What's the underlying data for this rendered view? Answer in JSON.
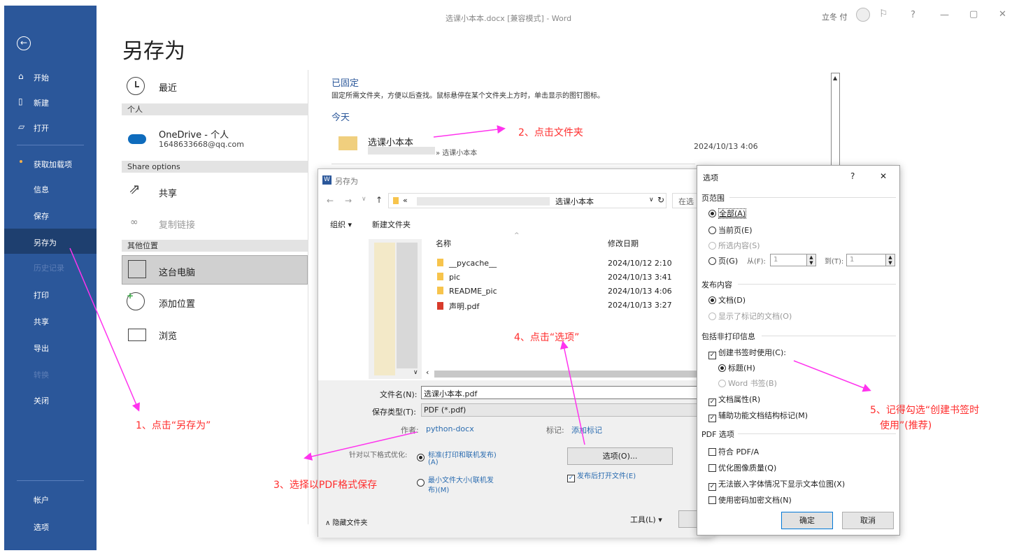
{
  "window": {
    "title": "选课小本本.docx [兼容模式] - Word",
    "user": "立冬 付",
    "controls": [
      "?",
      "—",
      "▢",
      "✕"
    ]
  },
  "rail": {
    "items": [
      {
        "label": "开始",
        "icon": "home-icon"
      },
      {
        "label": "新建",
        "icon": "new-doc-icon"
      },
      {
        "label": "打开",
        "icon": "open-folder-icon"
      },
      {
        "label": "获取加载项"
      },
      {
        "label": "信息"
      },
      {
        "label": "保存"
      },
      {
        "label": "另存为"
      },
      {
        "label": "历史记录"
      },
      {
        "label": "打印"
      },
      {
        "label": "共享"
      },
      {
        "label": "导出"
      },
      {
        "label": "转换"
      },
      {
        "label": "关闭"
      },
      {
        "label": "帐户"
      },
      {
        "label": "选项"
      }
    ]
  },
  "main": {
    "title": "另存为",
    "recent": "最近",
    "personal": "个人",
    "onedrive_name": "OneDrive - 个人",
    "onedrive_email": "1648633668@qq.com",
    "share_options": "Share options",
    "share": "共享",
    "copy_link": "复制链接",
    "other_locations": "其他位置",
    "this_pc": "这台电脑",
    "add_location": "添加位置",
    "browse": "浏览"
  },
  "pinned": {
    "title": "已固定",
    "desc": "固定所需文件夹，方便以后查找。鼠标悬停在某个文件夹上方时，单击显示的图钉图标。",
    "today": "今天",
    "folder_name": "选课小本本",
    "folder_path": "» 选课小本本",
    "folder_date": "2024/10/13 4:06"
  },
  "dialog": {
    "title": "另存为",
    "path_prefix": "«",
    "path_last": "选课小本本",
    "search": "在选",
    "organize": "组织 ▾",
    "new_folder": "新建文件夹",
    "col_name": "名称",
    "col_date": "修改日期",
    "files": [
      {
        "name": "__pycache__",
        "date": "2024/10/12 2:10",
        "type": "folder"
      },
      {
        "name": "pic",
        "date": "2024/10/13 3:41",
        "type": "folder"
      },
      {
        "name": "README_pic",
        "date": "2024/10/13 4:06",
        "type": "folder"
      },
      {
        "name": "声明.pdf",
        "date": "2024/10/13 3:27",
        "type": "pdf"
      }
    ],
    "filename_label": "文件名(N):",
    "filename_value": "选课小本本.pdf",
    "filetype_label": "保存类型(T):",
    "filetype_value": "PDF (*.pdf)",
    "author_label": "作者:",
    "author_value": "python-docx",
    "tags_label": "标记:",
    "tags_value": "添加标记",
    "optimize_label": "针对以下格式优化:",
    "opt_standard_line1": "标准(打印和联机发布)",
    "opt_standard_line2": "(A)",
    "opt_min_line1": "最小文件大小(联机发",
    "opt_min_line2": "布)(M)",
    "options_button": "选项(O)...",
    "open_after": "发布后打开文件(E)",
    "hide_folders": "∧ 隐藏文件夹",
    "tools": "工具(L)  ▾"
  },
  "options": {
    "title": "选项",
    "help": "?",
    "close": "✕",
    "page_range": "页范围",
    "all": "全部(A)",
    "current_page": "当前页(E)",
    "selection": "所选内容(S)",
    "pages": "页(G)",
    "from": "从(F):",
    "from_val": "1",
    "to": "到(T):",
    "to_val": "1",
    "publish_what": "发布内容",
    "document": "文档(D)",
    "doc_markup": "显示了标记的文档(O)",
    "non_print": "包括非打印信息",
    "create_bookmarks": "创建书签时使用(C):",
    "headings": "标题(H)",
    "word_bookmarks": "Word 书签(B)",
    "doc_props": "文档属性(R)",
    "struct_tags": "辅助功能文档结构标记(M)",
    "pdf_options": "PDF 选项",
    "pdfa": "符合 PDF/A",
    "optimize_img": "优化图像质量(Q)",
    "bitmap_text": "无法嵌入字体情况下显示文本位图(X)",
    "encrypt": "使用密码加密文档(N)",
    "ok": "确定",
    "cancel": "取消"
  },
  "annotations": {
    "a1": "1、点击“另存为”",
    "a2": "2、点击文件夹",
    "a3": "3、选择以PDF格式保存",
    "a4": "4、点击“选项”",
    "a5_line1": "5、记得勾选“创建书签时",
    "a5_line2": "使用”(推荐)",
    "color": "#ff2d2d",
    "arrow_color": "#ff33ee"
  }
}
